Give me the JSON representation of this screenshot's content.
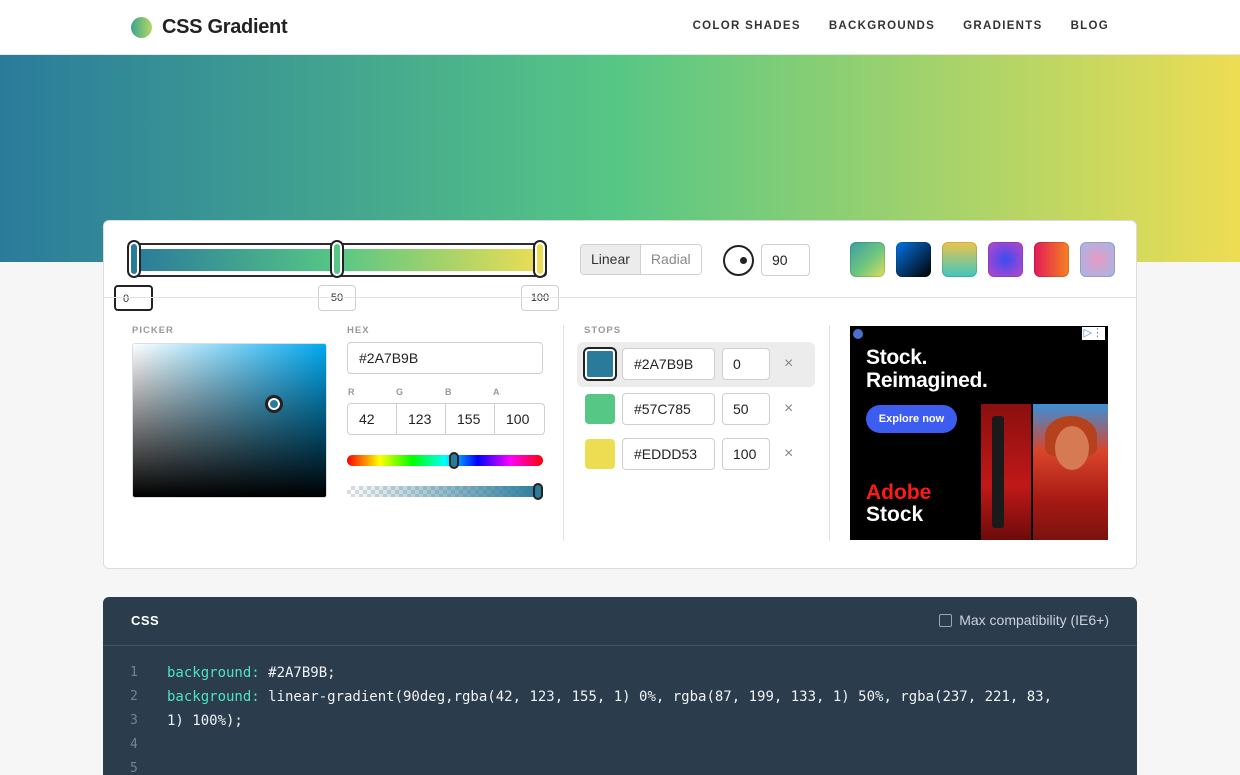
{
  "header": {
    "logo_text": "CSS Gradient",
    "nav": [
      "COLOR SHADES",
      "BACKGROUNDS",
      "GRADIENTS",
      "BLOG"
    ]
  },
  "gradient": {
    "css": "linear-gradient(90deg, #2A7B9B 0%, #57C785 50%, #EDDD53 100%)",
    "positions": [
      "0",
      "50",
      "100"
    ],
    "type_options": [
      "Linear",
      "Radial"
    ],
    "selected_type": "Linear",
    "angle": "90",
    "presets": [
      "linear-gradient(135deg,#3b9ea3,#6fc77e 55%,#e3dd55)",
      "linear-gradient(135deg,#021b79,#0575e6 0%,#000 100%)",
      "linear-gradient(180deg,#f0c44a,#3ec6c0)",
      "radial-gradient(circle,#3b4cf0,#c045c8)",
      "linear-gradient(90deg,#e11b5b,#f5821f)",
      "radial-gradient(circle,#e79ac4,#9fb9e9)"
    ]
  },
  "picker": {
    "label": "PICKER",
    "hex_label": "HEX",
    "hex_value": "#2A7B9B",
    "rgba_labels": [
      "R",
      "G",
      "B",
      "A"
    ],
    "rgba_values": [
      "42",
      "123",
      "155",
      "100"
    ]
  },
  "stops": {
    "label": "STOPS",
    "items": [
      {
        "color": "#2A7B9B",
        "hex": "#2A7B9B",
        "position": "0"
      },
      {
        "color": "#57C785",
        "hex": "#57C785",
        "position": "50"
      },
      {
        "color": "#EDDD53",
        "hex": "#EDDD53",
        "position": "100"
      }
    ],
    "remove_glyph": "×"
  },
  "ad": {
    "headline_1": "Stock.",
    "headline_2": "Reimagined.",
    "button": "Explore now",
    "brand_1": "Adobe",
    "brand_2": "Stock",
    "choices": "▷⋮"
  },
  "code": {
    "title": "CSS",
    "compat_label": "Max compatibility (IE6+)",
    "line_numbers": [
      "1",
      "2",
      "3",
      "4",
      "5"
    ],
    "line1_prop": "background:",
    "line1_val": " #2A7B9B;",
    "line2_prop": "background:",
    "line2_val": " linear-gradient(90deg,rgba(42, 123, 155, 1) 0%, rgba(87, 199, 133, 1) 50%, rgba(237, 221, 83,",
    "line3_val": "1) 100%);"
  }
}
